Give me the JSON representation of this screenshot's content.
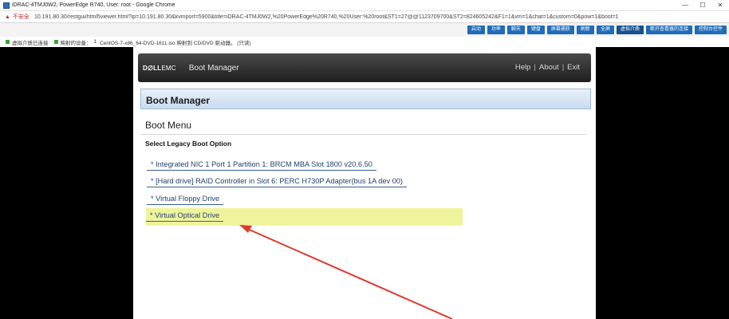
{
  "window": {
    "title": "iDRAC-4TMJ0W2, PowerEdge R740, User: root - Google Chrome",
    "minimize": "—",
    "maximize": "☐",
    "close": "✕"
  },
  "address": {
    "warning_icon": "warning-triangle-icon",
    "insecure_label": "不安全",
    "url": "10.191.80.30/restgui/html5viewer.html?ip=10.191.80.30&kvmport=5900&title=iDRAC-4TMJ0W2,%20PowerEdge%20R740,%20User:%20root&ST1=27@@1123709700&ST2=824605242&F1=1&vm=1&chat=1&custom=0&pow=1&boot=1"
  },
  "toolbar": {
    "buttons": [
      {
        "label": "启动"
      },
      {
        "label": "功率"
      },
      {
        "label": "聊天"
      },
      {
        "label": "键盘"
      },
      {
        "label": "屏幕捕获"
      },
      {
        "label": "刷新"
      },
      {
        "label": "全屏"
      },
      {
        "label": "虚拟介质"
      },
      {
        "label": "断开查看器的连接"
      },
      {
        "label": "控制台控件"
      }
    ]
  },
  "status": {
    "media_connected": "虚拟介质已连接",
    "mapped_devices": "映射的设备：",
    "device_count": "1",
    "device_desc": "CentOS-7-x86_64-DVD-1611.iso 映射到 CD/DVD 驱动器。 (只读)"
  },
  "console": {
    "logo_main": "D∅LL",
    "logo_sub": "EMC",
    "app_title": "Boot Manager",
    "links": {
      "help": "Help",
      "about": "About",
      "exit": "Exit",
      "sep": "|"
    },
    "section_title": "Boot Manager",
    "menu_title": "Boot Menu",
    "subheading": "Select Legacy Boot Option",
    "options": [
      {
        "label": "* Integrated NIC 1 Port 1 Partition 1: BRCM MBA Slot 1800 v20.6.50"
      },
      {
        "label": "* [Hard drive] RAID Controller in Slot 6: PERC H730P Adapter(bus 1A dev 00)"
      },
      {
        "label": "* Virtual Floppy Drive"
      },
      {
        "label": "* Virtual Optical Drive"
      }
    ],
    "selected_color": "#eff49c",
    "arrow_color": "#e03a2f"
  }
}
